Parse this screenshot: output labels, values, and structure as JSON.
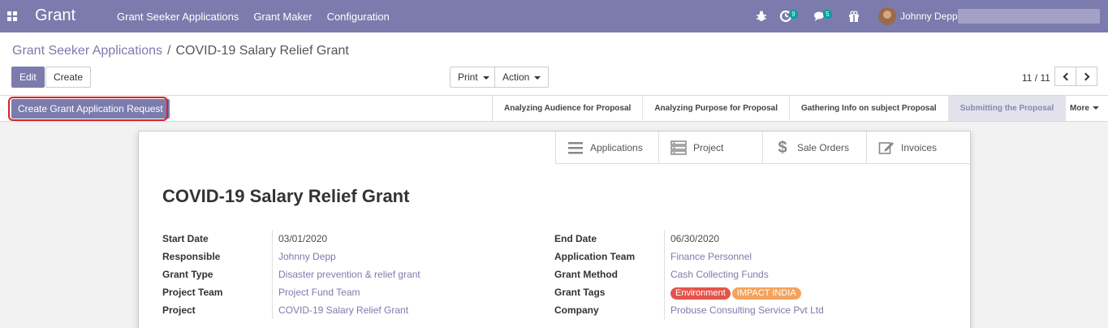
{
  "navbar": {
    "brand": "Grant",
    "menu": [
      "Grant Seeker Applications",
      "Grant Maker",
      "Configuration"
    ],
    "activity_count": "9",
    "message_count": "5",
    "user_name": "Johnny Depp"
  },
  "breadcrumb": {
    "parent": "Grant Seeker Applications",
    "separator": "/",
    "current": "COVID-19 Salary Relief Grant"
  },
  "buttons": {
    "edit": "Edit",
    "create": "Create",
    "print": "Print",
    "action": "Action"
  },
  "pager": {
    "text": "11 / 11"
  },
  "statusbar": {
    "create_request": "Create Grant Application Request",
    "stages": [
      {
        "label": "Analyzing Audience for Proposal",
        "active": false
      },
      {
        "label": "Analyzing Purpose for Proposal",
        "active": false
      },
      {
        "label": "Gathering Info on subject Proposal",
        "active": false
      },
      {
        "label": "Submitting the Proposal",
        "active": true
      }
    ],
    "more": "More"
  },
  "smart_buttons": [
    {
      "label": "Applications",
      "icon": "list-icon"
    },
    {
      "label": "Project",
      "icon": "project-icon"
    },
    {
      "label": "Sale Orders",
      "icon": "dollar-icon"
    },
    {
      "label": "Invoices",
      "icon": "edit-icon"
    }
  ],
  "record": {
    "title": "COVID-19 Salary Relief Grant",
    "left_fields": [
      {
        "label": "Start Date",
        "value": "03/01/2020",
        "link": false
      },
      {
        "label": "Responsible",
        "value": "Johnny Depp",
        "link": true
      },
      {
        "label": "Grant Type",
        "value": "Disaster prevention & relief grant",
        "link": true
      },
      {
        "label": "Project Team",
        "value": "Project Fund Team",
        "link": true
      },
      {
        "label": "Project",
        "value": "COVID-19 Salary Relief Grant",
        "link": true
      }
    ],
    "right_fields": [
      {
        "label": "End Date",
        "value": "06/30/2020"
      },
      {
        "label": "Application Team",
        "value": "Finance Personnel"
      },
      {
        "label": "Grant Method",
        "value": "Cash Collecting Funds"
      },
      {
        "label": "Grant Tags",
        "tags": [
          {
            "text": "Environment",
            "color": "#e4544a"
          },
          {
            "text": "IMPACT INDIA",
            "color": "#f3a35c"
          }
        ]
      },
      {
        "label": "Company",
        "value": "Probuse Consulting Service Pvt Ltd"
      }
    ]
  },
  "colors": {
    "brand": "#7c7bad",
    "highlight": "#d6232a",
    "badge": "#00a09d"
  }
}
